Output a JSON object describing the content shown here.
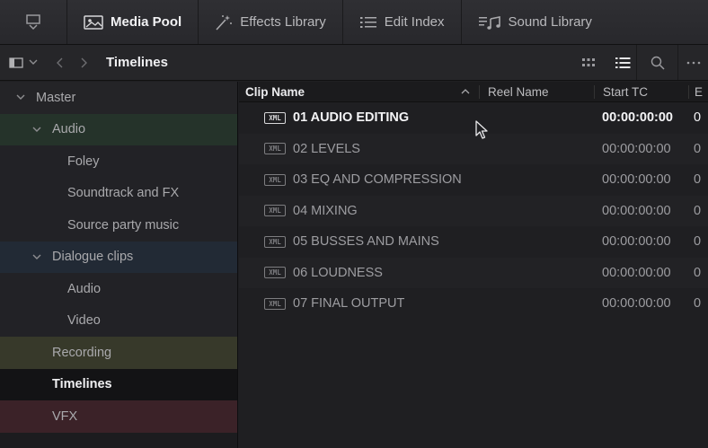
{
  "topbar": {
    "tabs": [
      {
        "label": "Media Pool",
        "icon": "media-pool-icon",
        "active": true
      },
      {
        "label": "Effects Library",
        "icon": "magic-wand-icon",
        "active": false
      },
      {
        "label": "Edit Index",
        "icon": "list-icon",
        "active": false
      },
      {
        "label": "Sound Library",
        "icon": "music-note-icon",
        "active": false
      }
    ]
  },
  "bin_bar": {
    "title": "Timelines"
  },
  "sidebar": {
    "items": [
      {
        "label": "Master"
      },
      {
        "label": "Audio"
      },
      {
        "label": "Foley"
      },
      {
        "label": "Soundtrack and FX"
      },
      {
        "label": "Source party music"
      },
      {
        "label": "Dialogue clips"
      },
      {
        "label": "Audio"
      },
      {
        "label": "Video"
      },
      {
        "label": "Recording"
      },
      {
        "label": "Timelines"
      },
      {
        "label": "VFX"
      }
    ],
    "colors": {
      "audio": "#25332a",
      "dialogue": "#222a35",
      "recording": "#37392a",
      "vfx": "#3b2228"
    }
  },
  "table": {
    "columns": {
      "name": "Clip Name",
      "reel": "Reel Name",
      "start_tc": "Start TC",
      "end": "E"
    },
    "file_badge": "XML",
    "rows": [
      {
        "name": "01 AUDIO EDITING",
        "reel": "",
        "start_tc": "00:00:00:00",
        "end": "0"
      },
      {
        "name": "02 LEVELS",
        "reel": "",
        "start_tc": "00:00:00:00",
        "end": "0"
      },
      {
        "name": "03 EQ AND COMPRESSION",
        "reel": "",
        "start_tc": "00:00:00:00",
        "end": "0"
      },
      {
        "name": "04 MIXING",
        "reel": "",
        "start_tc": "00:00:00:00",
        "end": "0"
      },
      {
        "name": "05 BUSSES AND MAINS",
        "reel": "",
        "start_tc": "00:00:00:00",
        "end": "0"
      },
      {
        "name": "06 LOUDNESS",
        "reel": "",
        "start_tc": "00:00:00:00",
        "end": "0"
      },
      {
        "name": "07 FINAL OUTPUT",
        "reel": "",
        "start_tc": "00:00:00:00",
        "end": "0"
      }
    ]
  }
}
